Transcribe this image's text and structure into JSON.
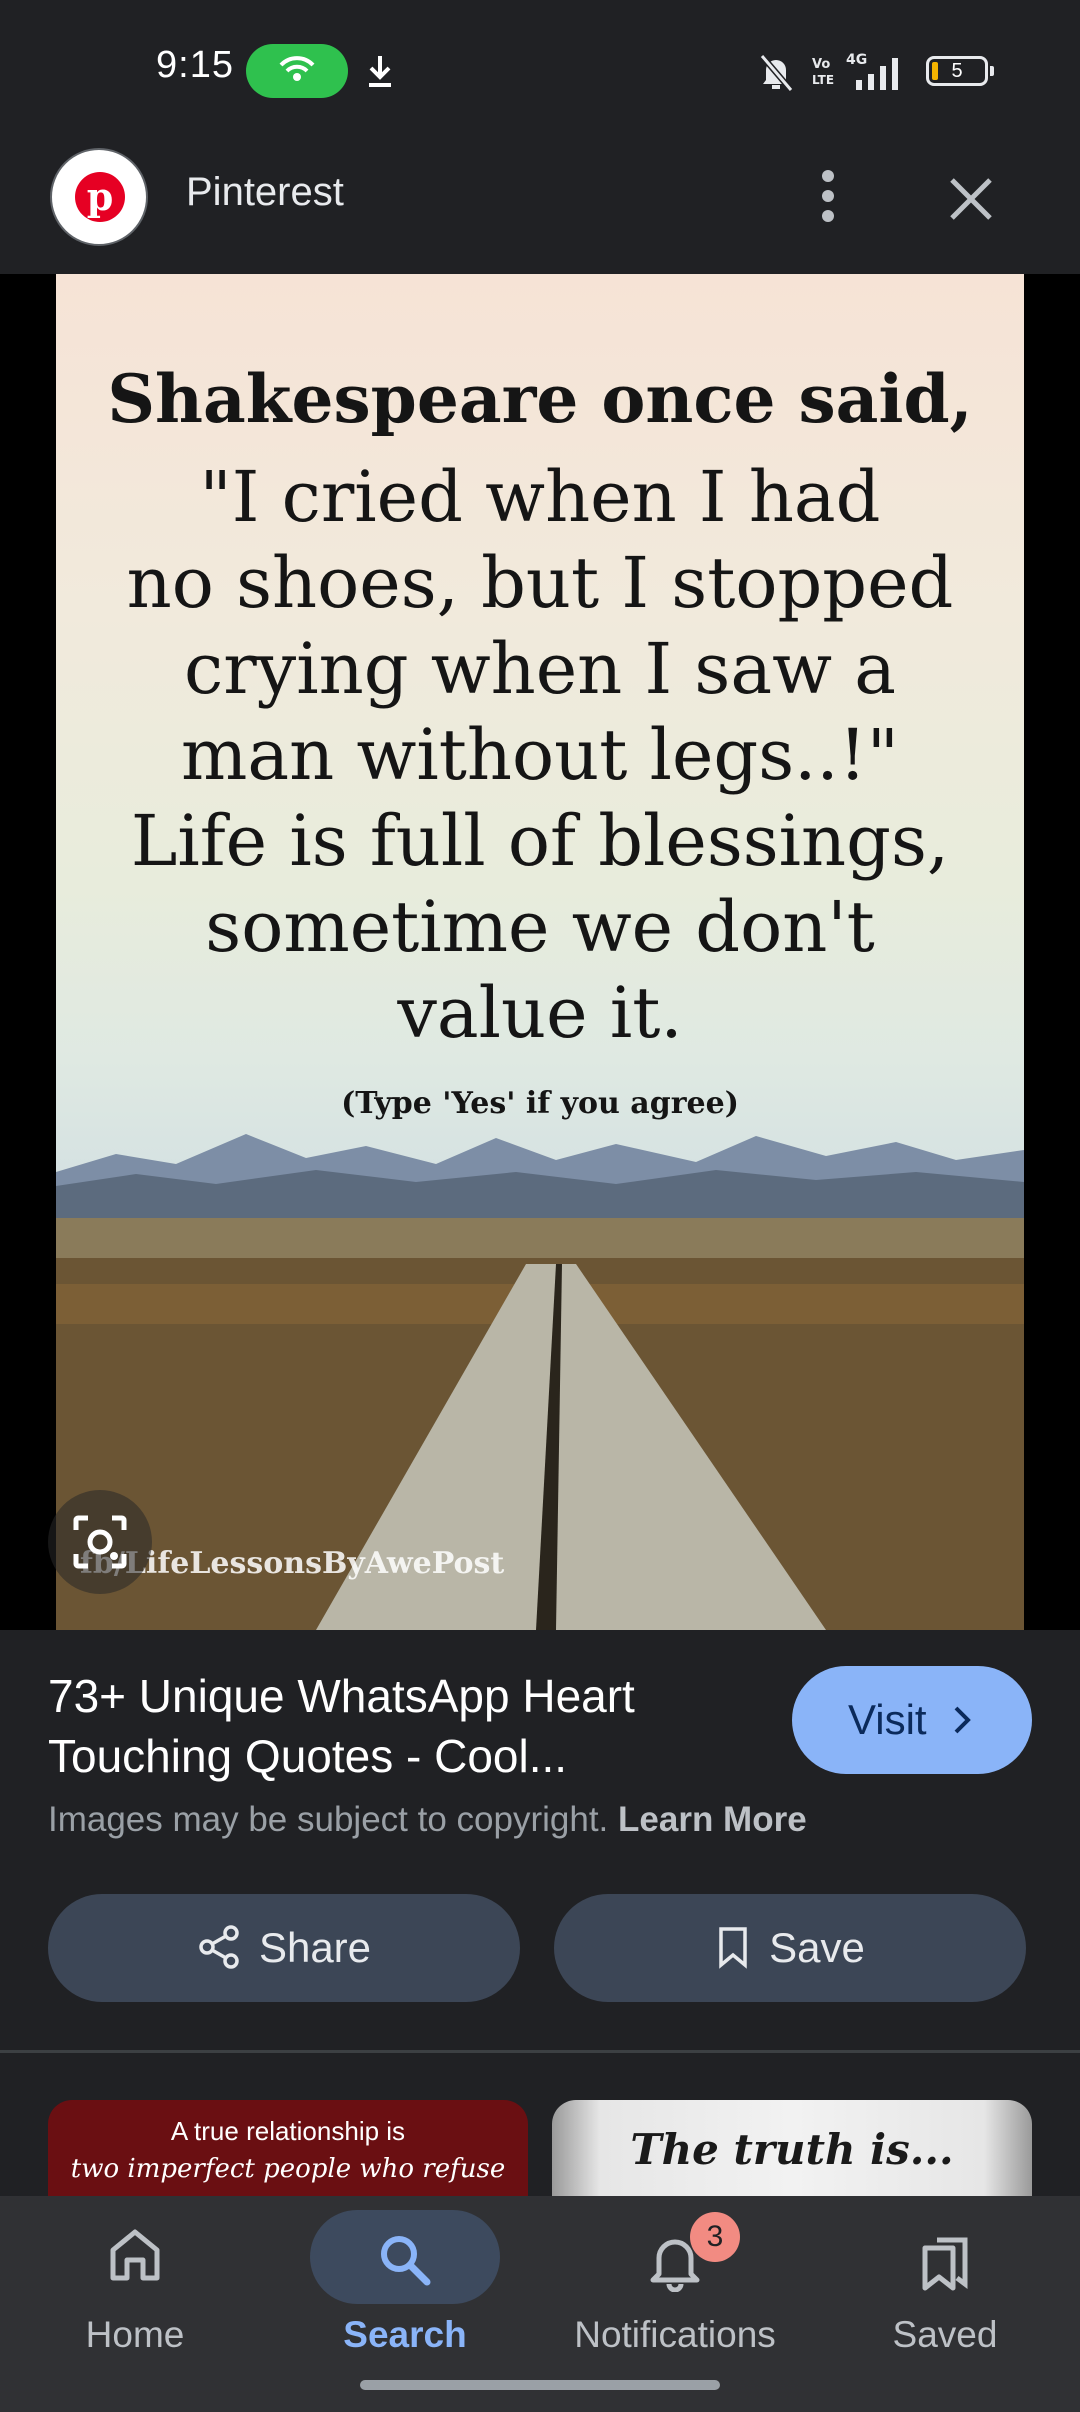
{
  "status_bar": {
    "time": "9:15",
    "battery_level": "5",
    "network": "4G",
    "icons": [
      "hotspot-icon",
      "download-icon",
      "mute-icon",
      "volte-icon",
      "signal-icon",
      "battery-icon"
    ]
  },
  "header": {
    "site_name": "Pinterest",
    "logo_letter": "p",
    "more_icon": "more-vert-icon",
    "close_icon": "close-icon"
  },
  "image": {
    "title_line": "Shakespeare once said,",
    "quote_lines": [
      "\"I cried when I had",
      "no shoes, but I stopped",
      "crying when I saw a",
      "man without legs..!\"",
      "Life is full of blessings,",
      "sometime we don't",
      "value it."
    ],
    "note": "(Type 'Yes' if you agree)",
    "watermark": "fb/LifeLessonsByAwePost",
    "lens_icon": "lens-icon"
  },
  "result": {
    "title": "73+ Unique WhatsApp Heart Touching Quotes - Cool...",
    "copyright_text": "Images may be subject to copyright.",
    "learn_more": "Learn More",
    "visit_label": "Visit",
    "share_label": "Share",
    "save_label": "Save"
  },
  "related": [
    {
      "line1": "A true relationship is",
      "line2": "two imperfect people who refuse"
    },
    {
      "line1": "The truth is..."
    }
  ],
  "bottom_nav": {
    "items": [
      {
        "label": "Home",
        "icon": "home-icon"
      },
      {
        "label": "Search",
        "icon": "search-icon",
        "active": true
      },
      {
        "label": "Notifications",
        "icon": "bell-icon",
        "badge": "3"
      },
      {
        "label": "Saved",
        "icon": "bookmarks-icon"
      }
    ]
  },
  "colors": {
    "background": "#202124",
    "accent": "#8ab4f8",
    "hotspot_green": "#2fc14e",
    "badge_red": "#f28b82",
    "pinterest_red": "#e60023"
  }
}
